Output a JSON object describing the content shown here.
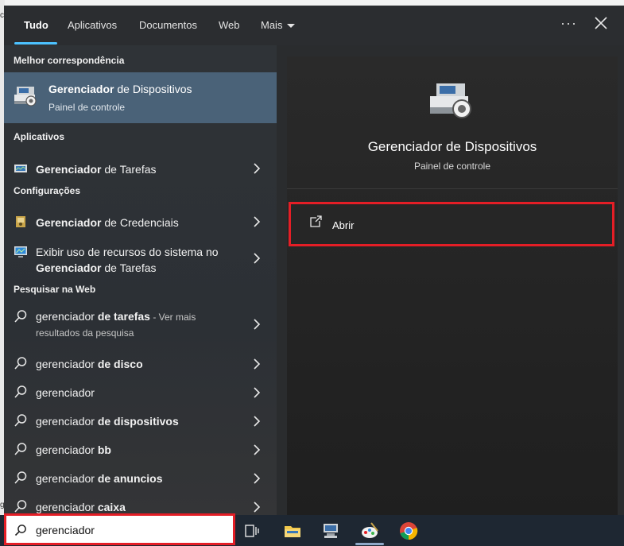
{
  "tabs": [
    {
      "label": "Tudo",
      "active": true
    },
    {
      "label": "Aplicativos"
    },
    {
      "label": "Documentos"
    },
    {
      "label": "Web"
    },
    {
      "label": "Mais"
    }
  ],
  "header": {
    "more_icon": "ellipsis-icon",
    "close_icon": "close-icon"
  },
  "sections": {
    "best_match": "Melhor correspondência",
    "apps": "Aplicativos",
    "settings": "Configurações",
    "web": "Pesquisar na Web"
  },
  "best_match": {
    "title_bold": "Gerenciador",
    "title_rest": " de Dispositivos",
    "subtitle": "Painel de controle",
    "icon": "device-manager-icon"
  },
  "apps": [
    {
      "bold": "Gerenciador",
      "rest": " de Tarefas",
      "icon": "task-manager-icon"
    }
  ],
  "settings": [
    {
      "bold": "Gerenciador",
      "rest": " de Credenciais",
      "icon": "credential-manager-icon"
    },
    {
      "line1": "Exibir uso de recursos do sistema no",
      "bold": "Gerenciador",
      "rest": " de Tarefas",
      "icon": "monitor-icon"
    }
  ],
  "web_results": [
    {
      "prefix": "gerenciador ",
      "bold": "de tarefas",
      "suffix": " - Ver mais",
      "line2": "resultados da pesquisa"
    },
    {
      "prefix": "gerenciador ",
      "bold": "de disco"
    },
    {
      "prefix": "gerenciador",
      "bold": ""
    },
    {
      "prefix": "gerenciador ",
      "bold": "de dispositivos"
    },
    {
      "prefix": "gerenciador ",
      "bold": "bb"
    },
    {
      "prefix": "gerenciador ",
      "bold": "de anuncios"
    },
    {
      "prefix": "gerenciador ",
      "bold": "caixa"
    }
  ],
  "preview": {
    "title": "Gerenciador de Dispositivos",
    "subtitle": "Painel de controle",
    "action_label": "Abrir",
    "action_icon": "open-external-icon"
  },
  "search": {
    "value": "gerenciador",
    "icon": "search-icon"
  },
  "taskbar": [
    "task-view-icon",
    "file-explorer-icon",
    "device-manager-icon",
    "paint-icon",
    "chrome-icon"
  ],
  "desktop_chars": [
    "c",
    "g"
  ],
  "colors": {
    "accent": "#4cc2ff",
    "highlight": "#4a6278",
    "annotation_red": "#e41e26"
  }
}
